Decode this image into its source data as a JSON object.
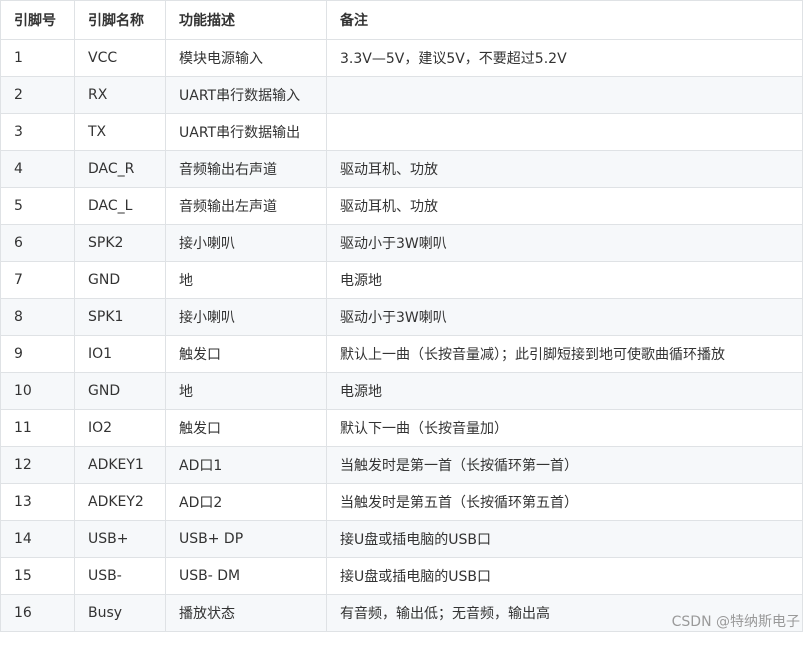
{
  "table": {
    "headers": [
      "引脚号",
      "引脚名称",
      "功能描述",
      "备注"
    ],
    "rows": [
      [
        "1",
        "VCC",
        "模块电源输入",
        "3.3V—5V，建议5V，不要超过5.2V"
      ],
      [
        "2",
        "RX",
        "UART串行数据输入",
        ""
      ],
      [
        "3",
        "TX",
        "UART串行数据输出",
        ""
      ],
      [
        "4",
        "DAC_R",
        "音频输出右声道",
        "驱动耳机、功放"
      ],
      [
        "5",
        "DAC_L",
        "音频输出左声道",
        "驱动耳机、功放"
      ],
      [
        "6",
        "SPK2",
        "接小喇叭",
        "驱动小于3W喇叭"
      ],
      [
        "7",
        "GND",
        "地",
        "电源地"
      ],
      [
        "8",
        "SPK1",
        "接小喇叭",
        "驱动小于3W喇叭"
      ],
      [
        "9",
        "IO1",
        "触发口",
        "默认上一曲（长按音量减）；此引脚短接到地可使歌曲循环播放"
      ],
      [
        "10",
        "GND",
        "地",
        "电源地"
      ],
      [
        "11",
        "IO2",
        "触发口",
        "默认下一曲（长按音量加）"
      ],
      [
        "12",
        "ADKEY1",
        "AD口1",
        "当触发时是第一首（长按循环第一首）"
      ],
      [
        "13",
        "ADKEY2",
        "AD口2",
        "当触发时是第五首（长按循环第五首）"
      ],
      [
        "14",
        "USB+",
        "USB+ DP",
        "接U盘或插电脑的USB口"
      ],
      [
        "15",
        "USB-",
        "USB- DM",
        "接U盘或插电脑的USB口"
      ],
      [
        "16",
        "Busy",
        "播放状态",
        "有音频，输出低；无音频，输出高"
      ]
    ]
  },
  "watermark": "CSDN @特纳斯电子"
}
